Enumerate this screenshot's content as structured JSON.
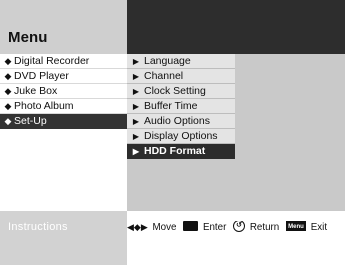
{
  "title": "Menu",
  "left_menu": {
    "items": [
      {
        "label": "Digital Recorder",
        "icon": "diamond-icon"
      },
      {
        "label": "DVD Player",
        "icon": "diamond-icon"
      },
      {
        "label": "Juke Box",
        "icon": "diamond-icon"
      },
      {
        "label": "Photo Album",
        "icon": "diamond-icon"
      },
      {
        "label": "Set-Up",
        "icon": "diamond-icon",
        "selected": true
      }
    ]
  },
  "sub_menu": {
    "items": [
      {
        "label": "Language",
        "icon": "arrow-right-icon"
      },
      {
        "label": "Channel",
        "icon": "arrow-right-icon"
      },
      {
        "label": "Clock Setting",
        "icon": "arrow-right-icon"
      },
      {
        "label": "Buffer Time",
        "icon": "arrow-right-icon"
      },
      {
        "label": "Audio Options",
        "icon": "arrow-right-icon"
      },
      {
        "label": "Display Options",
        "icon": "arrow-right-icon"
      },
      {
        "label": "HDD Format",
        "icon": "arrow-right-icon",
        "selected": true
      }
    ]
  },
  "instructions": {
    "label": "Instructions",
    "actions": [
      {
        "icon": "direction-icon",
        "label": "Move"
      },
      {
        "icon": "enter-icon",
        "label": "Enter"
      },
      {
        "icon": "return-icon",
        "label": "Return"
      },
      {
        "icon": "menu-button-icon",
        "label": "Exit",
        "badge": "Menu"
      }
    ]
  }
}
